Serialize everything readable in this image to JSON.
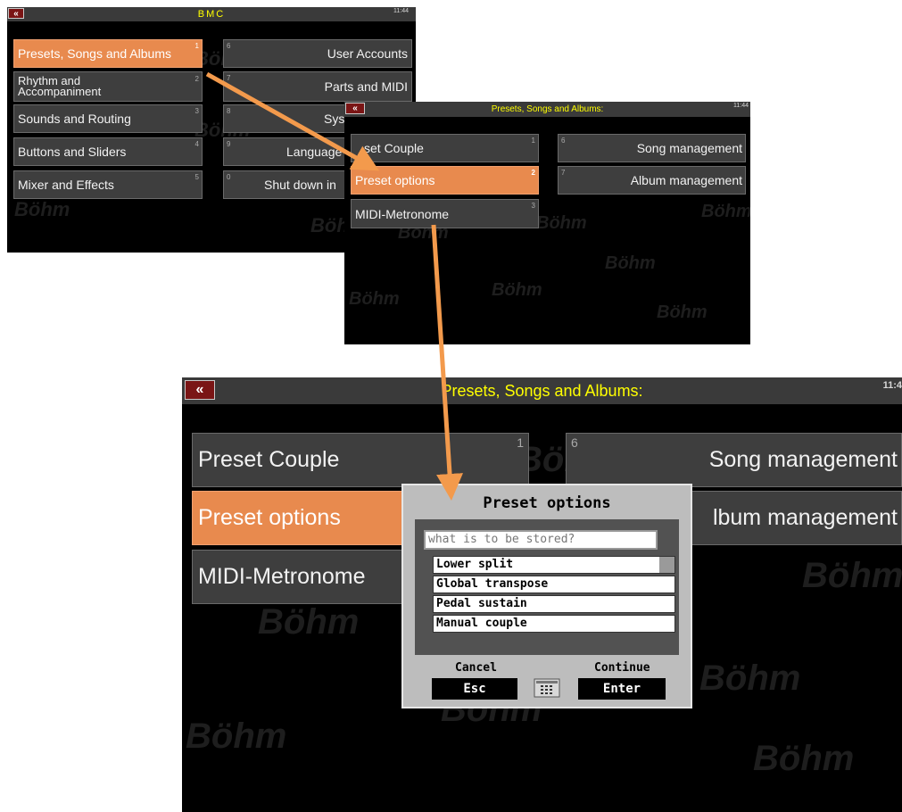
{
  "screen1": {
    "back_icon": "«",
    "title": "BMC",
    "clock": "11:44",
    "menu": [
      {
        "label": "Presets, Songs and Albums",
        "num": "1"
      },
      {
        "label": "Rhythm and Accompaniment",
        "num": "2"
      },
      {
        "label": "Sounds and Routing",
        "num": "3"
      },
      {
        "label": "Buttons and Sliders",
        "num": "4"
      },
      {
        "label": "Mixer and Effects",
        "num": "5"
      },
      {
        "label": "User Accounts",
        "num": "6"
      },
      {
        "label": "Parts and MIDI",
        "num": "7"
      },
      {
        "label": "Syste",
        "num": "8"
      },
      {
        "label": "Language",
        "num": "9"
      },
      {
        "label": "Shut down in",
        "num": "0"
      }
    ]
  },
  "screen2": {
    "back_icon": "«",
    "title": "Presets, Songs and Albums:",
    "clock": "11:44",
    "menu": [
      {
        "label": "set Couple",
        "num": "1"
      },
      {
        "label": "Preset options",
        "num": "2"
      },
      {
        "label": "MIDI-Metronome",
        "num": "3"
      },
      {
        "label": "Song management",
        "num": "6"
      },
      {
        "label": "Album management",
        "num": "7"
      }
    ]
  },
  "screen3": {
    "back_icon": "«",
    "title": "Presets, Songs and Albums:",
    "clock": "11:4",
    "menu": [
      {
        "label": "Preset Couple",
        "num": "1"
      },
      {
        "label": "Preset options",
        "num": ""
      },
      {
        "label": "MIDI-Metronome",
        "num": ""
      },
      {
        "label": "Song management",
        "num": "6"
      },
      {
        "label": "lbum management",
        "num": ""
      }
    ]
  },
  "watermark": "Böhm",
  "dialog": {
    "title": "Preset options",
    "input_value": "what is to be stored?",
    "items": [
      "Lower split",
      "Global transpose",
      "Pedal sustain",
      "Manual couple"
    ],
    "cancel_label": "Cancel",
    "cancel_key": "Esc",
    "continue_label": "Continue",
    "continue_key": "Enter",
    "keyboard_icon": "keyboard-icon"
  },
  "colors": {
    "accent_orange": "#e88a4e",
    "arrow": "#f39a4c",
    "title_yellow": "#ffff00",
    "back_red": "#7a1515"
  }
}
